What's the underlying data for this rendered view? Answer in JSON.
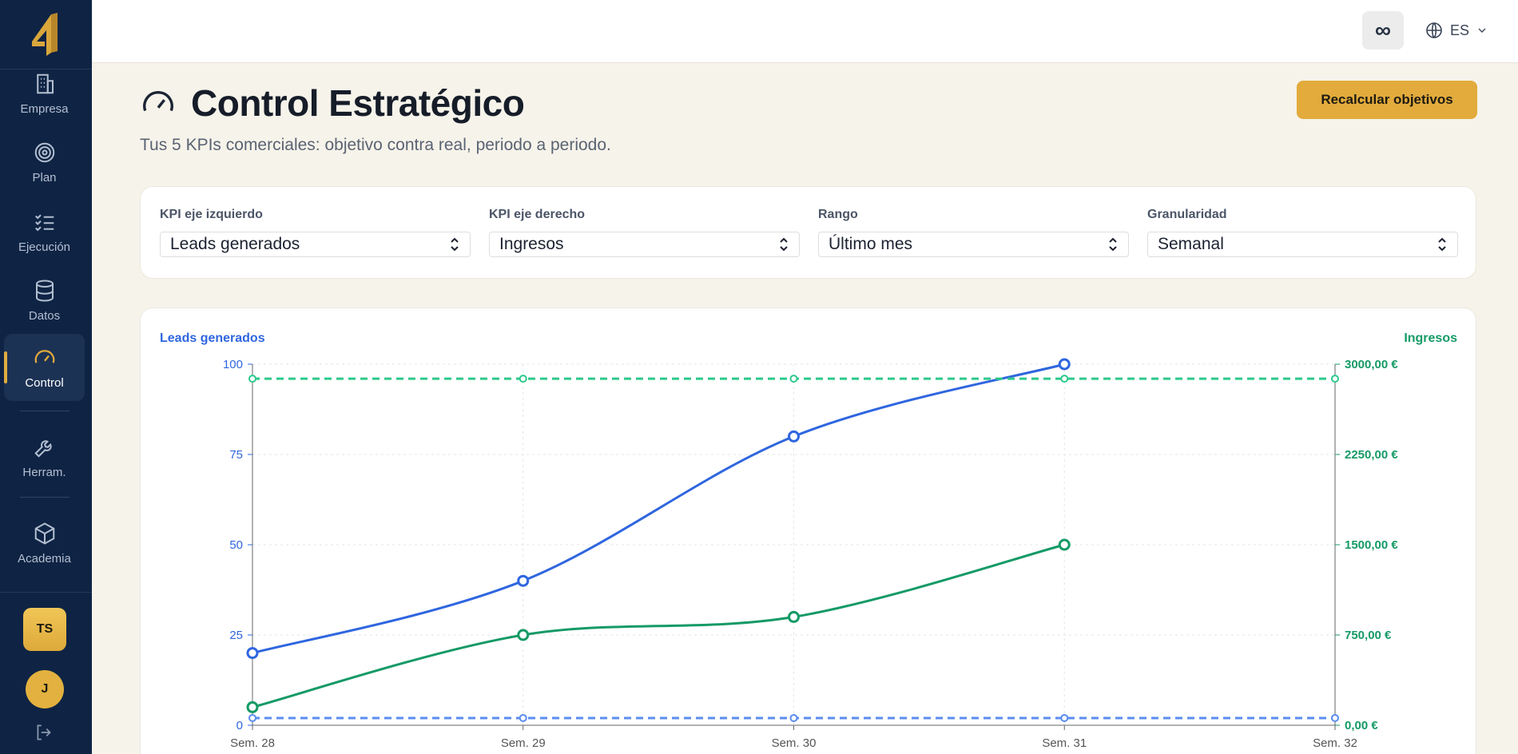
{
  "sidebar": {
    "items": [
      {
        "label": "Empresa",
        "icon": "building-icon"
      },
      {
        "label": "Plan",
        "icon": "target-icon"
      },
      {
        "label": "Ejecución",
        "icon": "checklist-icon"
      },
      {
        "label": "Datos",
        "icon": "database-icon"
      },
      {
        "label": "Control",
        "icon": "gauge-icon",
        "active": true
      },
      {
        "label": "Herram.",
        "icon": "wrench-icon"
      },
      {
        "label": "Academia",
        "icon": "box-icon"
      }
    ],
    "workspace_badge": "TS",
    "user_initial": "J"
  },
  "topbar": {
    "infinity_symbol": "∞",
    "language": "ES"
  },
  "header": {
    "title": "Control Estratégico",
    "subtitle": "Tus 5 KPIs comerciales: objetivo contra real, periodo a periodo.",
    "recalc_label": "Recalcular objetivos"
  },
  "filters": [
    {
      "label": "KPI eje izquierdo",
      "value": "Leads generados"
    },
    {
      "label": "KPI eje derecho",
      "value": "Ingresos"
    },
    {
      "label": "Rango",
      "value": "Último mes"
    },
    {
      "label": "Granularidad",
      "value": "Semanal"
    }
  ],
  "colors": {
    "accent": "#e2ab3c",
    "sidebar_bg": "#0f2444",
    "left_series": "#2f66df",
    "right_series": "#159a66",
    "left_target": "#5b8cf0",
    "right_target": "#2cc98a"
  },
  "chart_data": {
    "type": "line",
    "x": [
      "Sem. 28",
      "Sem. 29",
      "Sem. 30",
      "Sem. 31",
      "Sem. 32"
    ],
    "left_axis": {
      "label": "Leads generados",
      "range": [
        0,
        100
      ],
      "ticks": [
        0,
        25,
        50,
        75,
        100
      ],
      "tick_labels": [
        "0",
        "25",
        "50",
        "75",
        "100"
      ]
    },
    "right_axis": {
      "label": "Ingresos",
      "range": [
        0,
        3000
      ],
      "ticks": [
        0,
        750,
        1500,
        2250,
        3000
      ],
      "tick_labels": [
        "0,00 €",
        "750,00 €",
        "1500,00 €",
        "2250,00 €",
        "3000,00 €"
      ]
    },
    "series": [
      {
        "axis": "left",
        "values": [
          20,
          40,
          80,
          100,
          null
        ],
        "style": "solid"
      },
      {
        "axis": "right",
        "values": [
          150,
          750,
          900,
          1500,
          null
        ],
        "style": "solid"
      },
      {
        "axis": "left",
        "values": [
          2,
          2,
          2,
          2,
          2
        ],
        "style": "dashed"
      },
      {
        "axis": "right",
        "values": [
          2880,
          2880,
          2880,
          2880,
          2880
        ],
        "style": "dashed"
      }
    ],
    "grid": true,
    "legend": "none"
  }
}
